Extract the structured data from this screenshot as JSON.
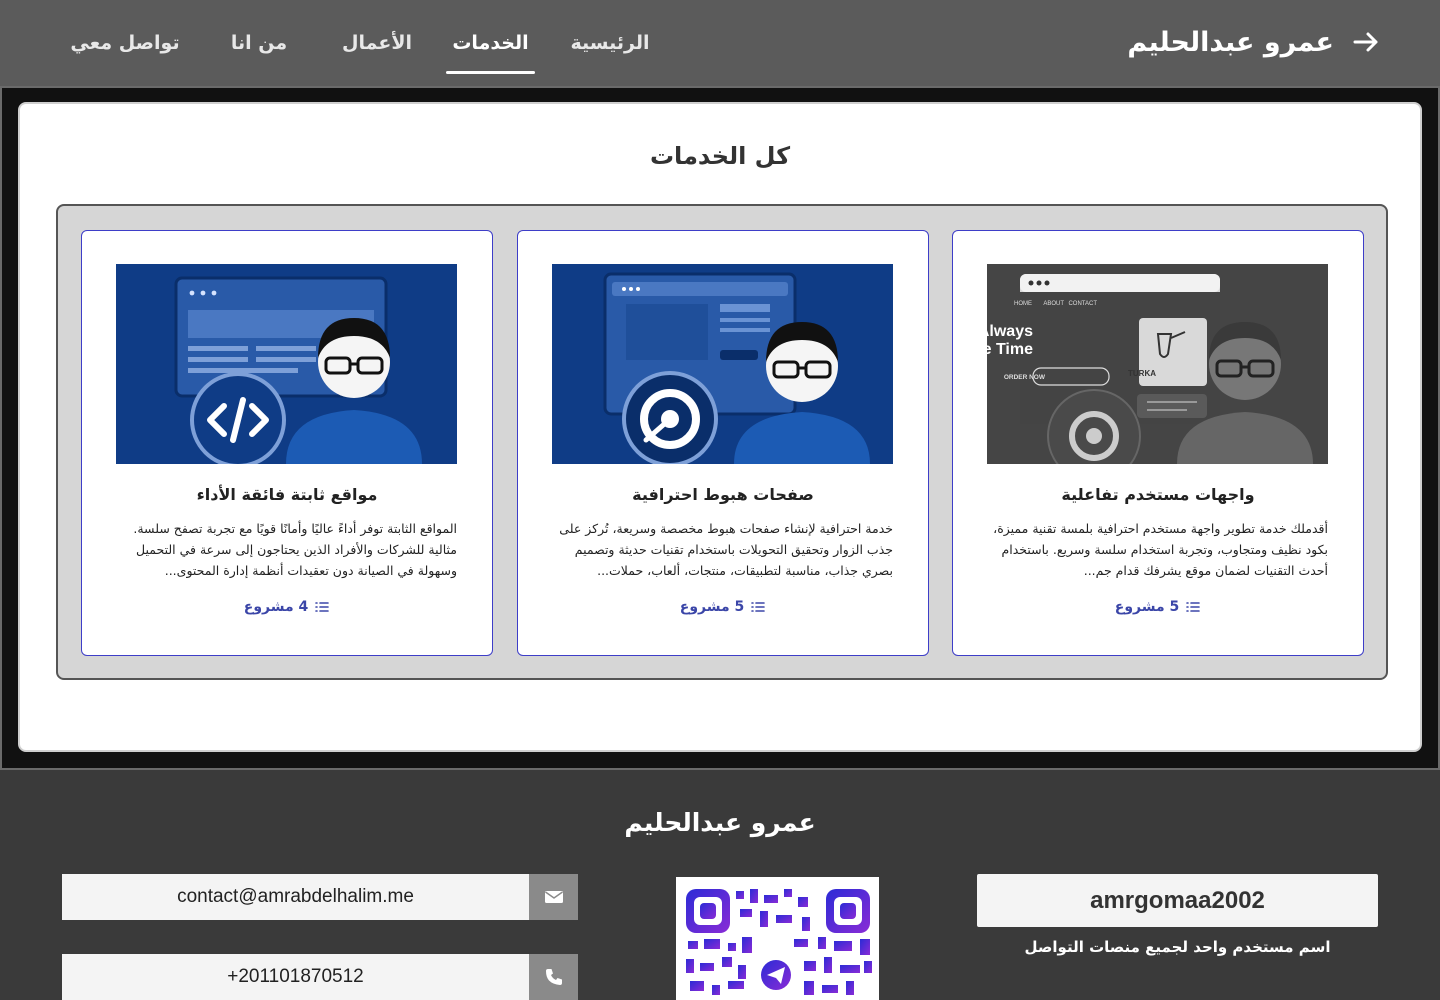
{
  "header": {
    "brand": "عمرو عبدالحليم",
    "nav": [
      {
        "label": "تواصل معي",
        "active": false
      },
      {
        "label": "من انا",
        "active": false
      },
      {
        "label": "الأعمال",
        "active": false
      },
      {
        "label": "الخدمات",
        "active": true
      },
      {
        "label": "الرئيسية",
        "active": false
      }
    ]
  },
  "services": {
    "title": "كل الخدمات",
    "cards": [
      {
        "title": "واجهات مستخدم تفاعلية",
        "description": "أقدملك خدمة تطوير واجهة مستخدم احترافية بلمسة تقنية مميزة، بكود نظيف ومتجاوب، وتجربة استخدام سلسة وسريع. باستخدام أحدث التقنيات لضمان موقع يشرفك قدام جم...",
        "count": "5 مشروع",
        "image": {
          "nav_links": [
            "HOME",
            "ABOUT",
            "CONTACT"
          ],
          "headline_1": "It's Always",
          "headline_2": "Coffee Time",
          "button": "ORDER NOW",
          "product": "TURKA"
        }
      },
      {
        "title": "صفحات هبوط احترافية",
        "description": "خدمة احترافية لإنشاء صفحات هبوط مخصصة وسريعة، تُركز على جذب الزوار وتحقيق التحويلات باستخدام تقنيات حديثة وتصميم بصري جذاب، مناسبة لتطبيقات، منتجات، ألعاب، حملات...",
        "count": "5 مشروع"
      },
      {
        "title": "مواقع ثابتة فائقة الأداء",
        "description": "المواقع الثابتة توفر أداءً عاليًا وأمانًا قويًا مع تجربة تصفح سلسة. مثالية للشركات والأفراد الذين يحتاجون إلى سرعة في التحميل وسهولة في الصيانة دون تعقيدات أنظمة إدارة المحتوى...",
        "count": "4 مشروع"
      }
    ]
  },
  "footer": {
    "name": "عمرو عبدالحليم",
    "username": "amrgomaa2002",
    "username_note": "اسم مستخدم واحد لجميع منصات التواصل",
    "email": "contact@amrabdelhalim.me",
    "phone": "+201101870512"
  },
  "icons": {
    "brand_arrow": "arrow-right-icon",
    "count": "list-icon",
    "email": "envelope-icon",
    "phone": "phone-icon"
  },
  "colors": {
    "header_bg": "#5b5b5b",
    "accent": "#3e3ec8",
    "card_image_blue": "#0f3c86",
    "footer_bg": "#3a3a3a"
  }
}
